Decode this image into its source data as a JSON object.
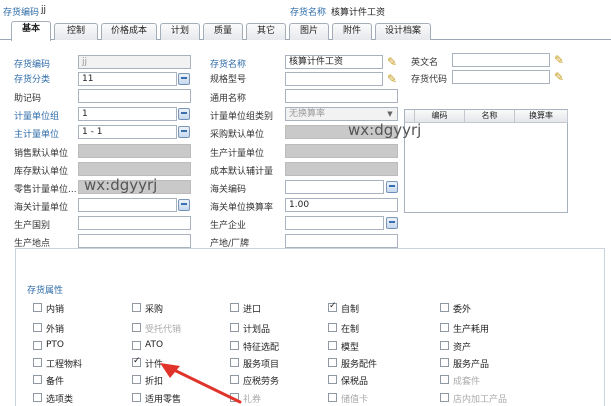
{
  "header": {
    "code_label": "存货编码",
    "code_value": "jj",
    "name_label": "存货名称",
    "name_value": "核算计件工资"
  },
  "tabs": [
    {
      "label": "基本"
    },
    {
      "label": "控制"
    },
    {
      "label": "价格成本"
    },
    {
      "label": "计划"
    },
    {
      "label": "质量"
    },
    {
      "label": "其它"
    },
    {
      "label": "图片"
    },
    {
      "label": "附件"
    },
    {
      "label": "设计档案"
    }
  ],
  "form": {
    "code_label": "存货编码",
    "code_value": "jj",
    "name_label": "存货名称",
    "name_value": "核算计件工资",
    "en_label": "英文名",
    "en_value": "",
    "category_label": "存货分类",
    "category_value": "11",
    "spec_label": "规格型号",
    "spec_value": "",
    "stockcode_label": "存货代码",
    "stockcode_value": "",
    "mnemonic_label": "助记码",
    "mnemonic_value": "",
    "generic_label": "通用名称",
    "generic_value": "",
    "uomgroup_label": "计量单位组",
    "uomgroup_value": "1",
    "uomgrouptype_label": "计量单位组类别",
    "uomgrouptype_value": "无换算率",
    "mainuom_label": "主计量单位",
    "mainuom_value": "1 - 1",
    "purchaseuom_label": "采购默认单位",
    "purchaseuom_value": "",
    "salesuom_label": "销售默认单位",
    "salesuom_value": "",
    "produom_label": "生产计量单位",
    "produom_value": "",
    "stockuom_label": "库存默认单位",
    "stockuom_value": "",
    "costuom_label": "成本默认辅计量",
    "costuom_value": "",
    "retailuom_label": "零售计量单位...",
    "retailuom_value": "",
    "customscode_label": "海关编码",
    "customscode_value": "",
    "customsuom_label": "海关计量单位",
    "customsuom_value": "",
    "customsrate_label": "海关单位换算率",
    "customsrate_value": "1.00",
    "country_label": "生产国别",
    "country_value": "",
    "company_label": "生产企业",
    "company_value": "",
    "location_label": "生产地点",
    "location_value": "",
    "origin_label": "产地/厂牌",
    "origin_value": ""
  },
  "grid": {
    "columns": [
      "编码",
      "名称",
      "换算率"
    ]
  },
  "watermark": "wx:dgyyrj",
  "attributes": {
    "title": "存货属性",
    "items": [
      {
        "label": "内销",
        "checked": false,
        "disabled": false
      },
      {
        "label": "采购",
        "checked": false,
        "disabled": false
      },
      {
        "label": "进口",
        "checked": false,
        "disabled": false
      },
      {
        "label": "自制",
        "checked": true,
        "disabled": false
      },
      {
        "label": "委外",
        "checked": false,
        "disabled": false
      },
      {
        "label": "外销",
        "checked": false,
        "disabled": false
      },
      {
        "label": "受托代销",
        "checked": false,
        "disabled": true
      },
      {
        "label": "计划品",
        "checked": false,
        "disabled": false
      },
      {
        "label": "在制",
        "checked": false,
        "disabled": false
      },
      {
        "label": "生产耗用",
        "checked": false,
        "disabled": false
      },
      {
        "label": "PTO",
        "checked": false,
        "disabled": false
      },
      {
        "label": "ATO",
        "checked": false,
        "disabled": false
      },
      {
        "label": "特征选配",
        "checked": false,
        "disabled": false
      },
      {
        "label": "模型",
        "checked": false,
        "disabled": false
      },
      {
        "label": "资产",
        "checked": false,
        "disabled": false
      },
      {
        "label": "工程物料",
        "checked": false,
        "disabled": false
      },
      {
        "label": "计件",
        "checked": true,
        "disabled": false
      },
      {
        "label": "服务项目",
        "checked": false,
        "disabled": false
      },
      {
        "label": "服务配件",
        "checked": false,
        "disabled": false
      },
      {
        "label": "服务产品",
        "checked": false,
        "disabled": false
      },
      {
        "label": "备件",
        "checked": false,
        "disabled": false
      },
      {
        "label": "折扣",
        "checked": false,
        "disabled": false
      },
      {
        "label": "应税劳务",
        "checked": false,
        "disabled": false
      },
      {
        "label": "保税品",
        "checked": false,
        "disabled": false
      },
      {
        "label": "成套件",
        "checked": false,
        "disabled": true
      },
      {
        "label": "选项类",
        "checked": false,
        "disabled": false
      },
      {
        "label": "适用零售",
        "checked": false,
        "disabled": false
      },
      {
        "label": "礼券",
        "checked": false,
        "disabled": true
      },
      {
        "label": "储值卡",
        "checked": false,
        "disabled": true
      },
      {
        "label": "店内加工产品",
        "checked": false,
        "disabled": true
      }
    ]
  },
  "colors": {
    "label_blue": "#2f6ca8",
    "arrow_red": "#e0342a"
  }
}
